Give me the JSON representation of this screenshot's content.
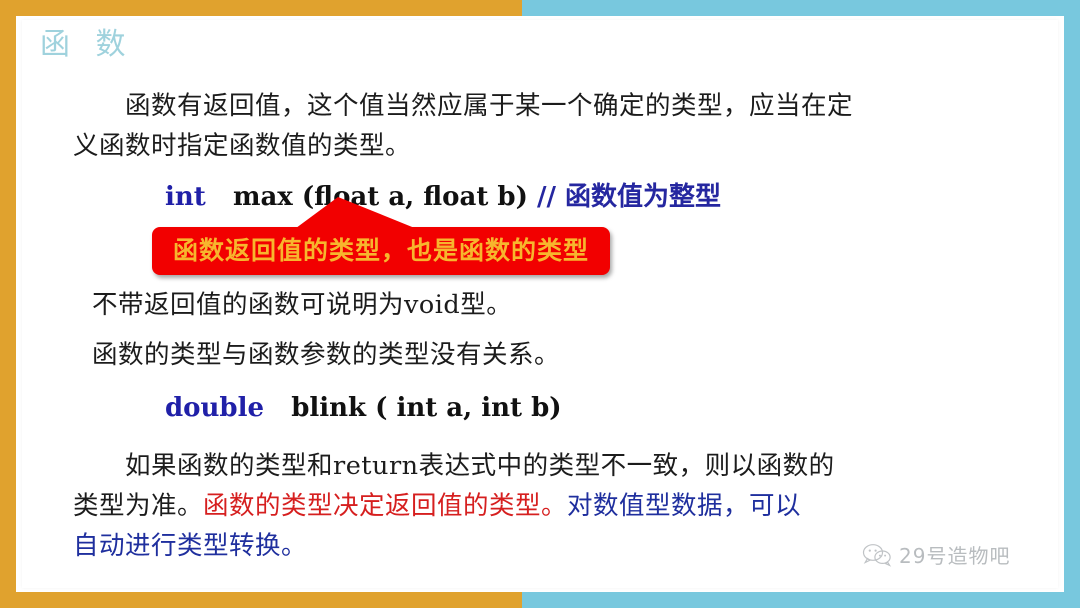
{
  "slide": {
    "title": "函 数",
    "colors": {
      "border_left": "#e0a22e",
      "border_right": "#78c8de",
      "title": "#9fd2dd",
      "accent_blue": "#1f2f9e",
      "accent_red": "#d61f1f",
      "callout_bg": "#f20000",
      "callout_text": "#f7b62d"
    }
  },
  "paragraph1": {
    "line1": "函数有返回值，这个值当然应属于某一个确定的类型，应当在定",
    "line2": "义函数时指定函数值的类型。"
  },
  "code1": {
    "keyword": "int",
    "signature": "max (float a,  float  b)",
    "comment": "// 函数值为整型"
  },
  "callout": {
    "text": "函数返回值的类型，也是函数的类型"
  },
  "paragraph2": {
    "text": "不带返回值的函数可说明为void型。"
  },
  "paragraph3": {
    "text": "函数的类型与函数参数的类型没有关系。"
  },
  "code2": {
    "keyword": "double",
    "signature": "blink ( int a,  int b)"
  },
  "paragraph4": {
    "part_black_1": "如果函数的类型和return表达式中的类型不一致，则以函数的",
    "part_black_2": "类型为准。",
    "part_red": "函数的类型决定返回值的类型。",
    "part_blue_1": "对数值型数据，可以",
    "part_blue_2": "自动进行类型转换。"
  },
  "watermark": {
    "icon": "wechat-icon",
    "label": "29号造物吧"
  }
}
